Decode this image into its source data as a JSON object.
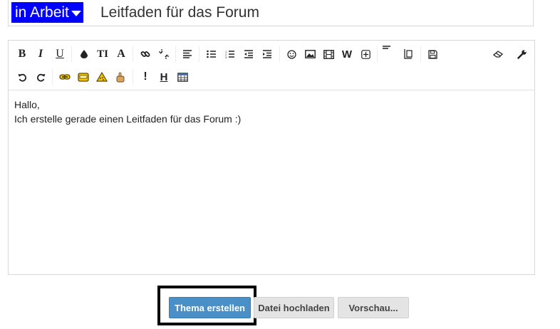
{
  "header": {
    "prefix_label": "in Arbeit",
    "title": "Leitfaden für das Forum",
    "prefix_color": "#0000ff"
  },
  "toolbar": {
    "row1": [
      {
        "name": "bold-button",
        "glyph": "B"
      },
      {
        "name": "italic-button",
        "glyph": "I"
      },
      {
        "name": "underline-button",
        "glyph": "U"
      },
      {
        "name": "text-color-button",
        "icon": "drop-icon"
      },
      {
        "name": "font-size-button",
        "glyph": "TI"
      },
      {
        "name": "font-family-button",
        "glyph": "A"
      },
      {
        "name": "insert-link-button",
        "icon": "link-icon"
      },
      {
        "name": "remove-link-button",
        "icon": "unlink-icon"
      },
      {
        "name": "align-button",
        "icon": "align-left-icon"
      },
      {
        "name": "bulleted-list-button",
        "icon": "bullet-list-icon"
      },
      {
        "name": "numbered-list-button",
        "icon": "numbered-list-icon"
      },
      {
        "name": "outdent-button",
        "icon": "outdent-icon"
      },
      {
        "name": "indent-button",
        "icon": "indent-icon"
      },
      {
        "name": "smilies-button",
        "icon": "smiley-icon"
      },
      {
        "name": "insert-image-button",
        "icon": "image-icon"
      },
      {
        "name": "insert-media-button",
        "icon": "film-icon"
      },
      {
        "name": "wiki-button",
        "glyph": "W"
      },
      {
        "name": "insert-more-button",
        "icon": "plus-box-icon"
      },
      {
        "name": "paragraph-format-button",
        "icon": "paragraph-icon"
      },
      {
        "name": "drafts-button",
        "icon": "drafts-icon"
      },
      {
        "name": "save-draft-button",
        "icon": "floppy-icon"
      },
      {
        "name": "remove-formatting-button",
        "icon": "eraser-icon"
      },
      {
        "name": "toggle-bbcode-button",
        "icon": "wrench-icon"
      }
    ],
    "row2": [
      {
        "name": "undo-button",
        "icon": "undo-icon"
      },
      {
        "name": "redo-button",
        "icon": "redo-icon"
      },
      {
        "name": "custom-link-button",
        "icon": "chain-icon"
      },
      {
        "name": "spoiler-button",
        "icon": "box-icon"
      },
      {
        "name": "warning-button",
        "icon": "warning-icon"
      },
      {
        "name": "hand-button",
        "icon": "hand-icon"
      },
      {
        "name": "important-button",
        "glyph": "!"
      },
      {
        "name": "heading-button",
        "glyph": "H"
      },
      {
        "name": "table-button",
        "icon": "table-icon"
      }
    ]
  },
  "editor": {
    "lines": [
      "Hallo,",
      "Ich erstelle gerade einen Leitfaden für das Forum :)"
    ]
  },
  "actions": {
    "create_label": "Thema erstellen",
    "upload_label": "Datei hochladen",
    "preview_label": "Vorschau..."
  }
}
